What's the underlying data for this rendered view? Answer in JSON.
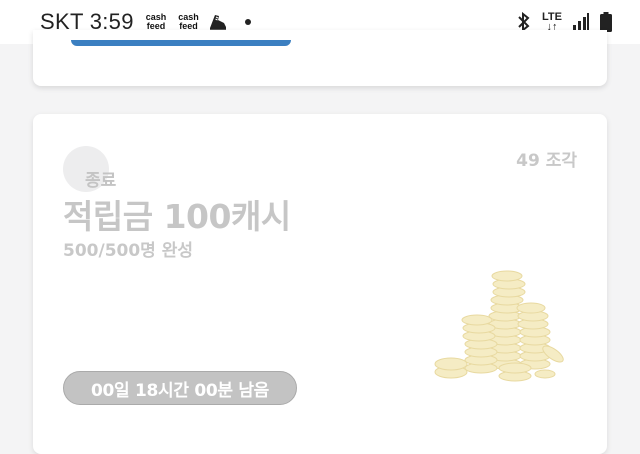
{
  "status_bar": {
    "carrier": "SKT",
    "time": "3:59",
    "notifications": [
      {
        "icon": "cashfeed-icon",
        "line1": "cash",
        "line2": "feed"
      },
      {
        "icon": "cashfeed-icon",
        "line1": "cash",
        "line2": "feed"
      },
      {
        "icon": "shoe-icon"
      },
      {
        "icon": "dot-icon"
      }
    ],
    "right_icons": [
      "bluetooth-icon",
      "lte-icon",
      "signal-icon",
      "battery-icon"
    ],
    "network": "LTE"
  },
  "reward_card": {
    "status": "종료",
    "pieces": "49 조각",
    "title": "적립금 100캐시",
    "progress": "500/500명 완성",
    "time_remaining": "00일 18시간 00분 남음",
    "image": "coins-stack"
  },
  "colors": {
    "accent_bar": "#3b7fc1",
    "disabled_text": "#c6c6c6",
    "pill_bg": "#c3c3c3"
  }
}
